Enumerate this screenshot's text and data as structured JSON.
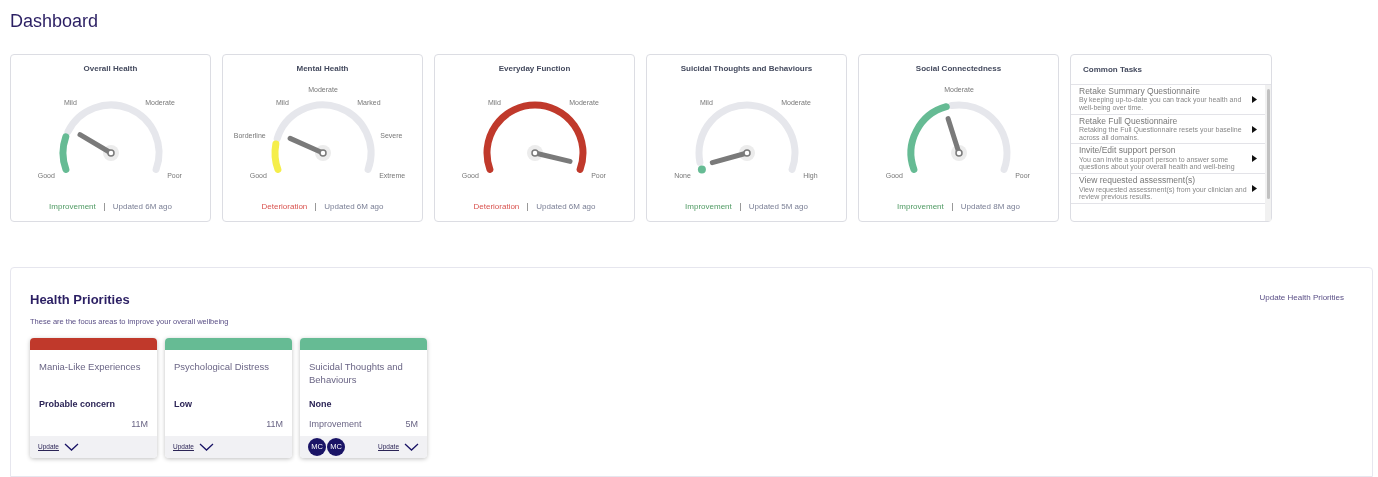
{
  "page_title": "Dashboard",
  "gauges": [
    {
      "title": "Overall Health",
      "labels": [
        "Good",
        "Mild",
        "Moderate",
        "Poor"
      ],
      "color": "#66bb94",
      "trend": {
        "kind": "improvement",
        "text": "Improvement"
      },
      "updated": "Updated 6M ago"
    },
    {
      "title": "Mental Health",
      "labels": [
        "Good",
        "Borderline",
        "Mild",
        "Moderate",
        "Marked",
        "Severe",
        "Extreme"
      ],
      "color": "#f5ee4a",
      "trend": {
        "kind": "deterioration",
        "text": "Deterioration"
      },
      "updated": "Updated 6M ago"
    },
    {
      "title": "Everyday Function",
      "labels": [
        "Good",
        "Mild",
        "Moderate",
        "Poor"
      ],
      "color": "#c0392b",
      "trend": {
        "kind": "deterioration",
        "text": "Deterioration"
      },
      "updated": "Updated 6M ago"
    },
    {
      "title": "Suicidal Thoughts and Behaviours",
      "labels": [
        "None",
        "Mild",
        "Moderate",
        "High"
      ],
      "color": "#66bb94",
      "trend": {
        "kind": "improvement",
        "text": "Improvement"
      },
      "updated": "Updated 5M ago"
    },
    {
      "title": "Social Connectedness",
      "labels": [
        "Good",
        "Moderate",
        "Poor"
      ],
      "color": "#66bb94",
      "trend": {
        "kind": "improvement",
        "text": "Improvement"
      },
      "updated": "Updated 8M ago"
    }
  ],
  "common_tasks": {
    "title": "Common Tasks",
    "items": [
      {
        "title": "Retake Summary Questionnaire",
        "description": "By keeping up-to-date you can track your health and well-being over time."
      },
      {
        "title": "Retake Full Questionnaire",
        "description": "Retaking the Full Questionnaire resets your baseline across all domains."
      },
      {
        "title": "Invite/Edit support person",
        "description": "You can invite a support person to answer some questions about your overall health and well-being"
      },
      {
        "title": "View requested assessment(s)",
        "description": "View requested assessment(s) from your clinician and review previous results."
      }
    ]
  },
  "health_priorities": {
    "title": "Health Priorities",
    "subtitle": "These are the focus areas to improve your overall wellbeing",
    "action": "Update Health Priorities",
    "cards": [
      {
        "title": "Mania-Like Experiences",
        "color": "#c0392b",
        "status": "Probable concern",
        "age": "11M",
        "update": "Update"
      },
      {
        "title": "Psychological Distress",
        "color": "#66bb94",
        "status": "Low",
        "age": "11M",
        "update": "Update"
      },
      {
        "title": "Suicidal Thoughts and Behaviours",
        "color": "#66bb94",
        "status": "None",
        "trend": "Improvement",
        "age": "5M",
        "avatars": [
          "MC",
          "MC"
        ],
        "update": "Update"
      }
    ]
  }
}
